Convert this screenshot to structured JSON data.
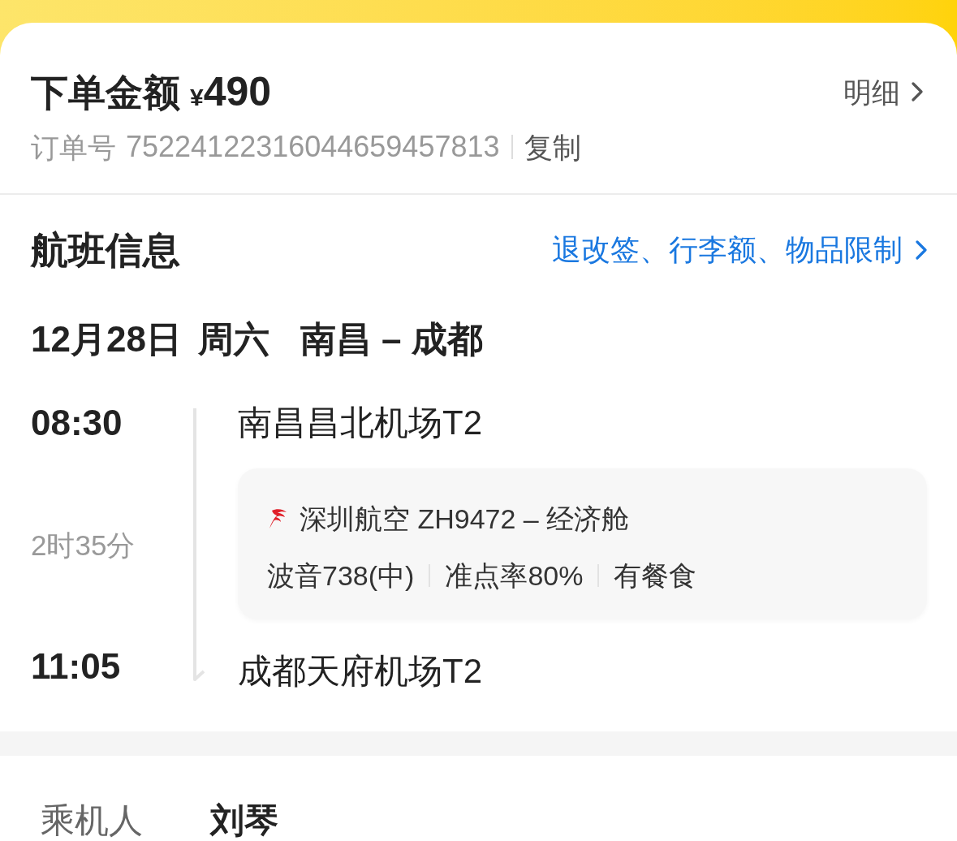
{
  "order_summary": {
    "amount_label": "下单金额",
    "currency": "¥",
    "amount": "490",
    "details_link": "明细",
    "order_number_label": "订单号",
    "order_number": "75224122316044659457813",
    "copy_button": "复制"
  },
  "flight_info": {
    "title": "航班信息",
    "rules_link": "退改签、行李额、物品限制",
    "date": "12月28日",
    "weekday": "周六",
    "route": "南昌 – 成都",
    "departure": {
      "time": "08:30",
      "airport": "南昌昌北机场T2"
    },
    "duration": "2时35分",
    "flight_card": {
      "airline_flight": "深圳航空 ZH9472 – 经济舱",
      "details": [
        "波音738(中)",
        "准点率80%",
        "有餐食"
      ]
    },
    "arrival": {
      "time": "11:05",
      "airport": "成都天府机场T2"
    }
  },
  "passenger": {
    "label": "乘机人",
    "name": "刘琴"
  }
}
